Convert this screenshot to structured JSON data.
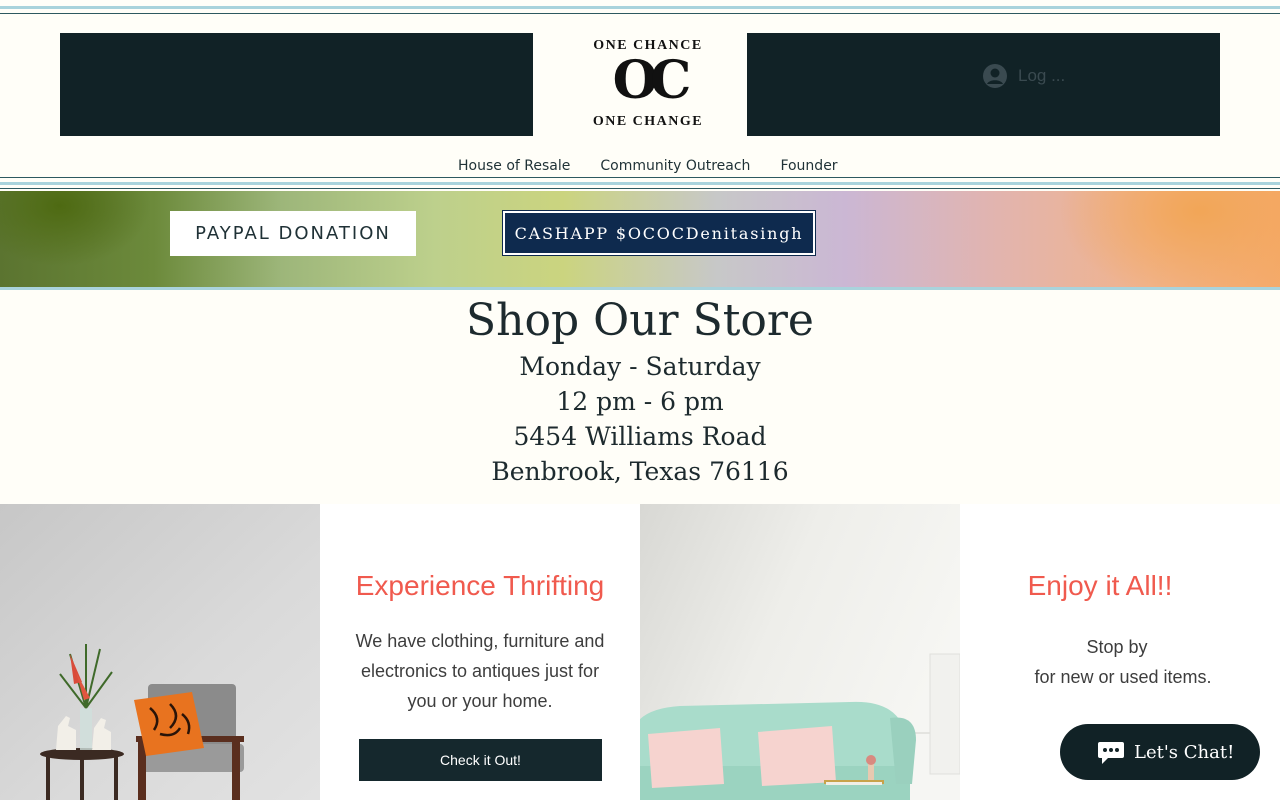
{
  "header": {
    "logo_top": "ONE CHANCE",
    "logo_mark": "OC",
    "logo_bottom": "ONE CHANGE",
    "login_label": "Log ...",
    "login_icon": "avatar-icon"
  },
  "nav": {
    "items": [
      {
        "label": "House of Resale"
      },
      {
        "label": "Community Outreach"
      },
      {
        "label": "Founder"
      }
    ]
  },
  "banner": {
    "paypal_label": "PAYPAL DONATION",
    "cashapp_label": "CASHAPP $OCOCDenitasingh"
  },
  "store": {
    "title": "Shop Our Store",
    "days": "Monday - Saturday",
    "hours": "12 pm - 6 pm",
    "street": "5454 Williams Road",
    "city": "Benbrook, Texas 76116"
  },
  "features": {
    "col1_title": "Experience Thrifting",
    "col1_line1": "We have clothing, furniture and",
    "col1_line2": "electronics to antiques just for",
    "col1_line3": "you or your home.",
    "col1_button": "Check it Out!",
    "col2_title": "Enjoy it All!!",
    "col2_line1": "Stop by",
    "col2_line2": "for new or used items."
  },
  "chat": {
    "label": "Let's Chat!",
    "icon": "chat-bubble-icon"
  },
  "colors": {
    "dark_teal": "#112226",
    "accent_coral": "#f05a4e",
    "cashapp_navy": "#0e2a4e",
    "rule_light_blue": "#a9d3dc"
  }
}
